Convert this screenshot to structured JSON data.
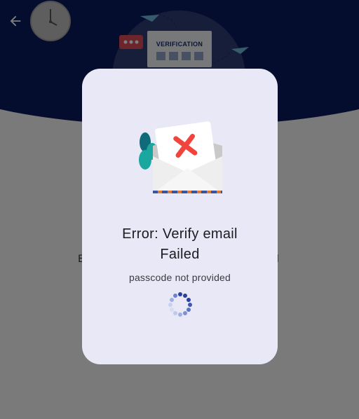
{
  "screen": {
    "background_behind_text_left": "E",
    "background_behind_text_right": "l"
  },
  "header": {
    "back_icon": "arrow-back-icon",
    "clock_icon": "clock-icon",
    "verification_card_title": "VERIFICATION"
  },
  "dialog": {
    "illustration_icon": "email-failed-envelope-icon",
    "title": "Error: Verify email Failed",
    "subtitle": "passcode not provided",
    "loading_icon": "loading-spinner-icon"
  },
  "colors": {
    "hero_navy": "#0b1a5c",
    "dialog_background": "#e8e8f6",
    "error_red": "#f0443c",
    "accent_teal": "#1aa7a0"
  }
}
